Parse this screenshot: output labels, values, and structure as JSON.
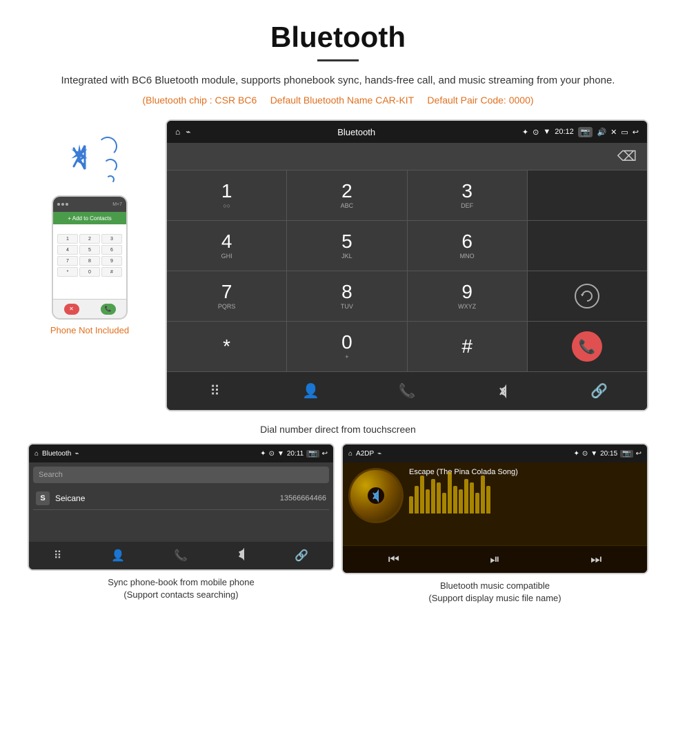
{
  "page": {
    "title": "Bluetooth",
    "description": "Integrated with BC6 Bluetooth module, supports phonebook sync, hands-free call, and music streaming from your phone.",
    "specs": {
      "chip": "(Bluetooth chip : CSR BC6",
      "name": "Default Bluetooth Name CAR-KIT",
      "code": "Default Pair Code: 0000)"
    }
  },
  "phone_label": "Phone Not Included",
  "dial_screen": {
    "statusbar": {
      "title": "Bluetooth",
      "time": "20:12",
      "usb_icon": "⌁",
      "bt_icon": "✦",
      "location_icon": "⊙",
      "wifi_icon": "▼",
      "camera_icon": "📷",
      "volume_icon": "🔊",
      "close_icon": "✕",
      "window_icon": "▭",
      "back_icon": "↩"
    },
    "keys": [
      {
        "number": "1",
        "letters": "○○"
      },
      {
        "number": "2",
        "letters": "ABC"
      },
      {
        "number": "3",
        "letters": "DEF"
      },
      {
        "number": "",
        "letters": ""
      },
      {
        "number": "4",
        "letters": "GHI"
      },
      {
        "number": "5",
        "letters": "JKL"
      },
      {
        "number": "6",
        "letters": "MNO"
      },
      {
        "number": "",
        "letters": ""
      },
      {
        "number": "7",
        "letters": "PQRS"
      },
      {
        "number": "8",
        "letters": "TUV"
      },
      {
        "number": "9",
        "letters": "WXYZ"
      },
      {
        "number": "",
        "letters": ""
      },
      {
        "number": "*",
        "letters": ""
      },
      {
        "number": "0",
        "letters": "+"
      },
      {
        "number": "#",
        "letters": ""
      }
    ],
    "bottom_nav": [
      "⠿",
      "👤",
      "📞",
      "✦",
      "🔗"
    ]
  },
  "caption_dial": "Dial number direct from touchscreen",
  "phonebook_screen": {
    "statusbar_title": "Bluetooth",
    "time": "20:11",
    "search_placeholder": "Search",
    "contact": {
      "letter": "S",
      "name": "Seicane",
      "number": "13566664466"
    },
    "nav_items": [
      "⠿",
      "👤",
      "📞",
      "✦",
      "🔗"
    ]
  },
  "music_screen": {
    "statusbar_title": "A2DP",
    "time": "20:15",
    "song_title": "Escape (The Pina Colada Song)",
    "eq_bars": [
      25,
      40,
      55,
      35,
      50,
      45,
      30,
      60,
      40,
      35,
      50,
      45,
      30,
      55,
      40
    ],
    "controls": [
      "⏮",
      "⏯",
      "⏭"
    ]
  },
  "caption_phonebook": "Sync phone-book from mobile phone\n(Support contacts searching)",
  "caption_music": "Bluetooth music compatible\n(Support display music file name)"
}
